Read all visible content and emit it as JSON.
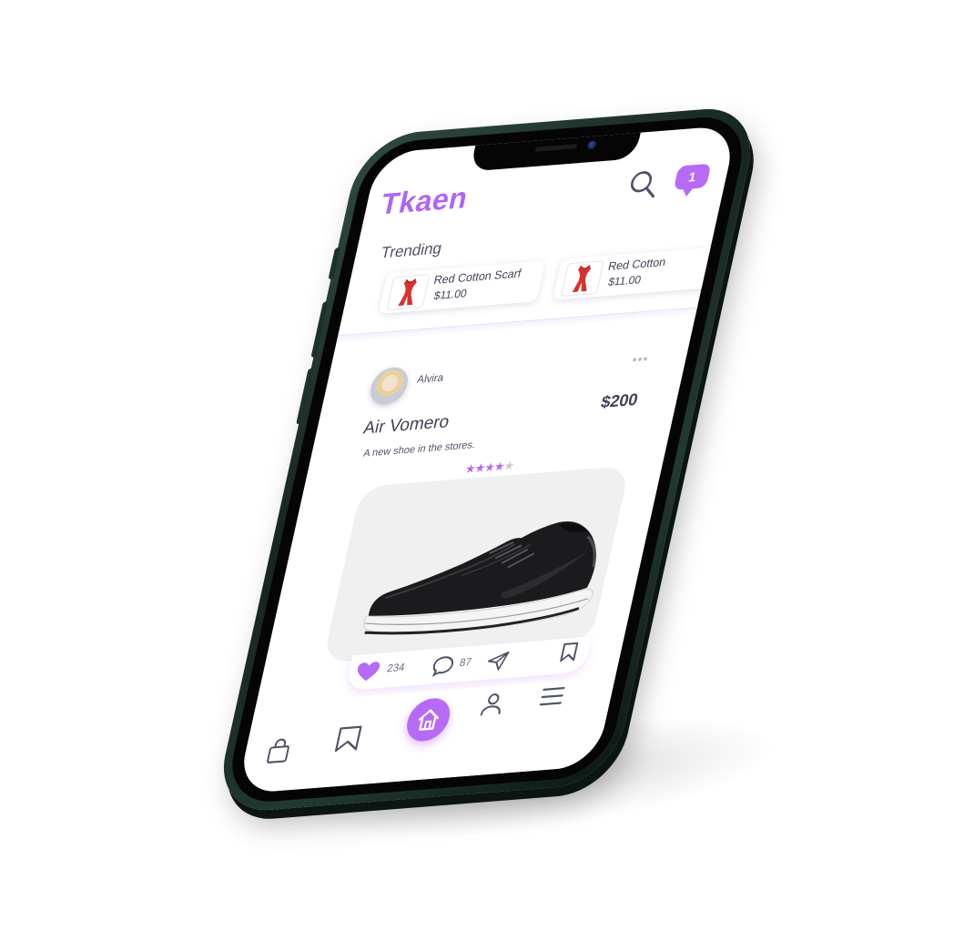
{
  "brand": "Tkaen",
  "header": {
    "chat_badge_count": "1"
  },
  "trending": {
    "title": "Trending",
    "items": [
      {
        "name": "Red Cotton Scarf",
        "price": "$11.00"
      },
      {
        "name": "Red Cotton",
        "price": "$11.00"
      }
    ]
  },
  "post": {
    "author": "Alvira",
    "more_label": "•••",
    "product_title": "Air Vomero",
    "price": "$200",
    "description": "A new shoe in the stores.",
    "rating": 4,
    "rating_max": 5,
    "likes": "234",
    "comments": "87"
  },
  "colors": {
    "accent": "#b76af5",
    "text": "#4a4d63",
    "frame": "#17251f"
  },
  "icons": {
    "header": [
      "search-icon",
      "chat-icon"
    ],
    "post_actions": [
      "heart-icon",
      "comment-icon",
      "send-icon",
      "bookmark-icon"
    ],
    "bottom_nav": [
      "shopping-bag-icon",
      "bookmark-icon",
      "home-icon",
      "user-icon",
      "menu-icon"
    ]
  }
}
